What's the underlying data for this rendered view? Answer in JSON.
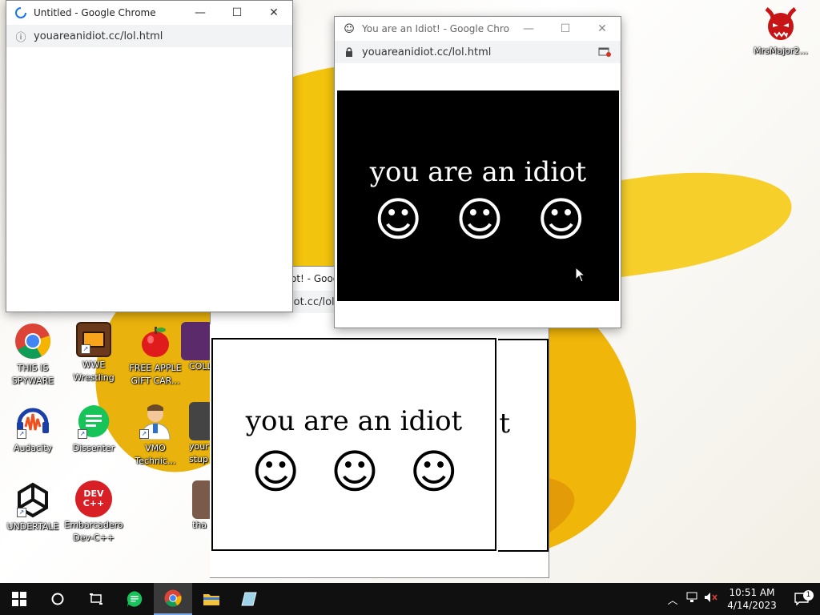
{
  "desktop": {
    "icons": [
      {
        "label": "THIS IS\nSPYWARE",
        "icon": "chrome-icon"
      },
      {
        "label": "WWE\nWrestling",
        "icon": "oven-icon"
      },
      {
        "label": "FREE APPLE\nGIFT CAR...",
        "icon": "apple-icon"
      },
      {
        "label": "Audacity",
        "icon": "audacity-icon"
      },
      {
        "label": "Dissenter",
        "icon": "chat-icon"
      },
      {
        "label": "VMO\nTechnic...",
        "icon": "doctor-icon"
      },
      {
        "label": "UNDERTALE",
        "icon": "unity-icon"
      },
      {
        "label": "Embarcadero\nDev-C++",
        "icon": "devcpp-icon"
      },
      {
        "label": "MrsMajor2...",
        "icon": "demon-icon"
      }
    ],
    "partial_labels": [
      "COLL",
      "your\nstup",
      "tha"
    ],
    "devcpp_badge": "DEV\nC++"
  },
  "window_back": {
    "title": "Untitled - Google Chrome",
    "url": "youareanidiot.cc/lol.html"
  },
  "window_front": {
    "title": "You are an Idiot! - Google Chrome",
    "url": "youareanidiot.cc/lol.html",
    "message": "you are an idiot",
    "faces": [
      "☺",
      "☺",
      "☺"
    ]
  },
  "window_middle": {
    "title_fragment": "ot! - Goog",
    "url_fragment": "iot.cc/lol",
    "message": "you are an idiot",
    "message_fragment": "ot",
    "faces": [
      "☺",
      "☺",
      "☺"
    ]
  },
  "taskbar": {
    "time": "10:51 AM",
    "date": "4/14/2023",
    "notifications": "1"
  },
  "colors": {
    "taskbar": "#101010",
    "wallpaper_accent": "#f3c40d",
    "active_indicator": "#7aa7e6"
  }
}
